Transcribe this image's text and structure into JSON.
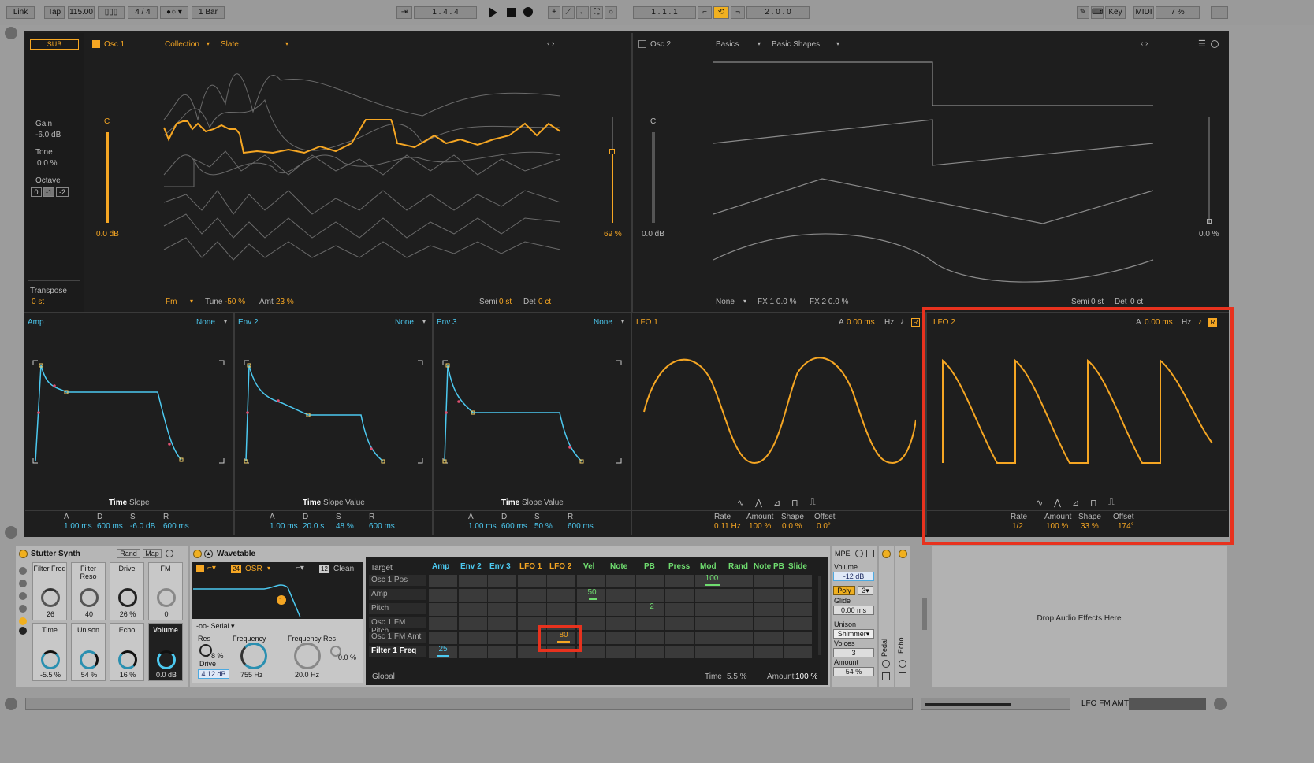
{
  "transport": {
    "link": "Link",
    "tap": "Tap",
    "tempo": "115.00",
    "signature": "4 / 4",
    "quantize": "1 Bar",
    "arrangement_pos": "1 .   4 .   4",
    "loop_start": "1 .   1 .   1",
    "loop_length": "2 .   0 .   0",
    "key": "Key",
    "midi": "MIDI",
    "cpu": "7 %"
  },
  "sub": {
    "label": "SUB",
    "gain_label": "Gain",
    "gain": "-6.0 dB",
    "tone_label": "Tone",
    "tone": "0.0 %",
    "octave_label": "Octave",
    "octaves": [
      "0",
      "-1",
      "-2"
    ],
    "transpose_label": "Transpose",
    "transpose": "0 st"
  },
  "osc1": {
    "title": "Osc 1",
    "category": "Collection",
    "wavetable": "Slate",
    "note": "C",
    "level": "0.0 dB",
    "position": "69 %",
    "fx_mode": "Fm",
    "tune_label": "Tune",
    "tune": "-50 %",
    "amt_label": "Amt",
    "amt": "23 %",
    "semi_label": "Semi",
    "semi": "0 st",
    "det_label": "Det",
    "det": "0 ct"
  },
  "osc2": {
    "title": "Osc 2",
    "category": "Basics",
    "wavetable": "Basic Shapes",
    "note": "C",
    "level": "0.0 dB",
    "position": "0.0 %",
    "fx_mode": "None",
    "fx1": "FX 1  0.0 %",
    "fx2": "FX 2  0.0 %",
    "semi_label": "Semi",
    "semi": "0 st",
    "det_label": "Det",
    "det": "0 ct"
  },
  "envelopes": [
    {
      "title": "Amp",
      "slope": "None",
      "modes": [
        "Time",
        "Slope"
      ],
      "params": [
        "A",
        "D",
        "S",
        "R"
      ],
      "values": [
        "1.00 ms",
        "600 ms",
        "-6.0 dB",
        "600 ms"
      ]
    },
    {
      "title": "Env 2",
      "slope": "None",
      "modes": [
        "Time",
        "Slope",
        "Value"
      ],
      "params": [
        "A",
        "D",
        "S",
        "R"
      ],
      "values": [
        "1.00 ms",
        "20.0 s",
        "48 %",
        "600 ms"
      ]
    },
    {
      "title": "Env 3",
      "slope": "None",
      "modes": [
        "Time",
        "Slope",
        "Value"
      ],
      "params": [
        "A",
        "D",
        "S",
        "R"
      ],
      "values": [
        "1.00 ms",
        "600 ms",
        "50 %",
        "600 ms"
      ]
    }
  ],
  "lfo1": {
    "title": "LFO 1",
    "attack_label": "A",
    "attack": "0.00 ms",
    "unit": "Hz",
    "params": [
      "Rate",
      "Amount",
      "Shape",
      "Offset"
    ],
    "values": [
      "0.11 Hz",
      "100 %",
      "0.0 %",
      "0.0°"
    ]
  },
  "lfo2": {
    "title": "LFO 2",
    "attack_label": "A",
    "attack": "0.00 ms",
    "unit": "Hz",
    "params": [
      "Rate",
      "Amount",
      "Shape",
      "Offset"
    ],
    "values": [
      "1/2",
      "100 %",
      "33 %",
      "174°"
    ]
  },
  "rack": {
    "name": "Stutter Synth",
    "rand": "Rand",
    "map": "Map",
    "macros": [
      {
        "label": "Filter Freq",
        "value": "26"
      },
      {
        "label": "Filter Reso",
        "value": "40"
      },
      {
        "label": "Drive",
        "value": "26 %"
      },
      {
        "label": "FM",
        "value": "0"
      },
      {
        "label": "Time",
        "value": "-5.5 %"
      },
      {
        "label": "Unison",
        "value": "54 %"
      },
      {
        "label": "Echo",
        "value": "16 %"
      },
      {
        "label": "Volume",
        "value": "0.0 dB"
      }
    ]
  },
  "wavetable": {
    "name": "Wavetable",
    "filter_slope": "24",
    "osr": "OSR",
    "slope2": "12",
    "circuit": "Clean",
    "routing": "Serial",
    "res_label": "Res",
    "res": "48 %",
    "drive_label": "Drive",
    "drive": "4.12 dB",
    "freq_label": "Frequency",
    "freq": "755 Hz",
    "freq2_label": "Frequency Res",
    "freq2": "20.0 Hz",
    "res2": "0.0 %",
    "filter_node": "1",
    "filter2_node": "2"
  },
  "matrix": {
    "target_label": "Target",
    "columns": [
      "Amp",
      "Env 2",
      "Env 3",
      "LFO 1",
      "LFO 2",
      "Vel",
      "Note",
      "PB",
      "Press",
      "Mod",
      "Rand",
      "Note PB",
      "Slide"
    ],
    "rows": [
      "Osc 1 Pos",
      "Amp",
      "Pitch",
      "Osc 1 FM Pitch",
      "Osc 1 FM Amt",
      "Filter 1 Freq"
    ],
    "cells": [
      {
        "row": 0,
        "col": 9,
        "value": "100"
      },
      {
        "row": 1,
        "col": 5,
        "value": "50"
      },
      {
        "row": 2,
        "col": 7,
        "value": "2"
      },
      {
        "row": 4,
        "col": 4,
        "value": "80"
      },
      {
        "row": 5,
        "col": 1,
        "value": "25"
      }
    ],
    "global_label": "Global",
    "time_label": "Time",
    "time": "5.5 %",
    "amount_label": "Amount",
    "amount": "100 %"
  },
  "voice": {
    "mpe": "MPE",
    "volume_label": "Volume",
    "volume": "-12 dB",
    "poly": "Poly",
    "voices_count": "3",
    "glide_label": "Glide",
    "glide": "0.00 ms",
    "unison_label": "Unison",
    "unison_mode": "Shimmer",
    "voices_label": "Voices",
    "voices": "3",
    "amount_label": "Amount",
    "amount": "54 %"
  },
  "side_devices": [
    "Pedal",
    "Echo"
  ],
  "drop_zone": "Drop Audio Effects Here",
  "status": {
    "text": "LFO FM AMT"
  },
  "colors": {
    "accent": "#f5a623",
    "env": "#4cc9f0",
    "highlight": "#e8321e",
    "panel": "#1e1e1e"
  }
}
